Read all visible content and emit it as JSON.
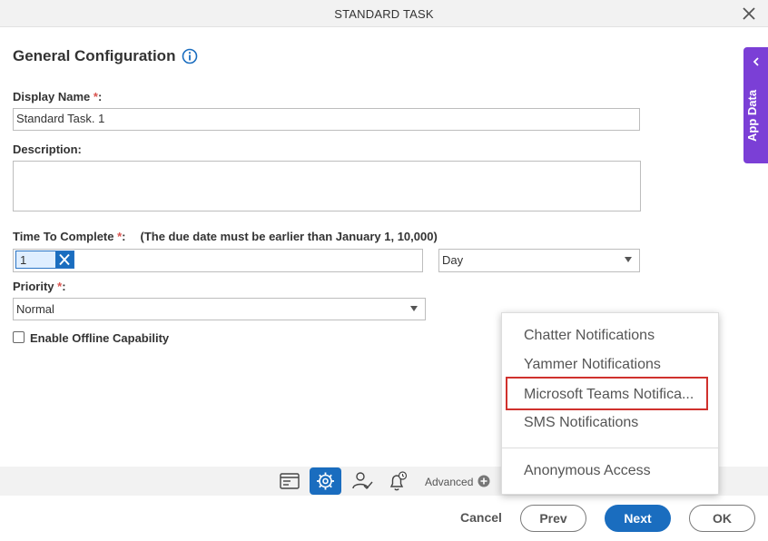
{
  "window": {
    "title": "STANDARD TASK"
  },
  "form": {
    "section_title": "General Configuration",
    "display_name": {
      "label": "Display Name ",
      "required": "*",
      "colon": ":",
      "value": "Standard Task. 1"
    },
    "description": {
      "label": "Description:"
    },
    "time_to_complete": {
      "label": "Time To Complete ",
      "required": "*",
      "colon": ":",
      "note": "(The due date must be earlier than January 1, 10,000)",
      "value": "1",
      "unit": "Day"
    },
    "priority": {
      "label": "Priority ",
      "required": "*",
      "colon": ":",
      "value": "Normal"
    },
    "offline": {
      "label": "Enable Offline Capability",
      "checked": false
    }
  },
  "side_panel": {
    "label": "App Data"
  },
  "toolbar": {
    "advanced_label": "Advanced"
  },
  "footer": {
    "cancel": "Cancel",
    "prev": "Prev",
    "next": "Next",
    "ok": "OK"
  },
  "advanced_menu": {
    "items": [
      "Chatter Notifications",
      "Yammer Notifications",
      "Microsoft Teams Notifica...",
      "SMS Notifications",
      "Anonymous Access"
    ],
    "highlighted_item": "Microsoft Teams Notifica..."
  },
  "colors": {
    "accent": "#1a6dbf",
    "side_panel": "#7b3fd6",
    "required": "#d9534f",
    "highlight": "#d0312d"
  }
}
